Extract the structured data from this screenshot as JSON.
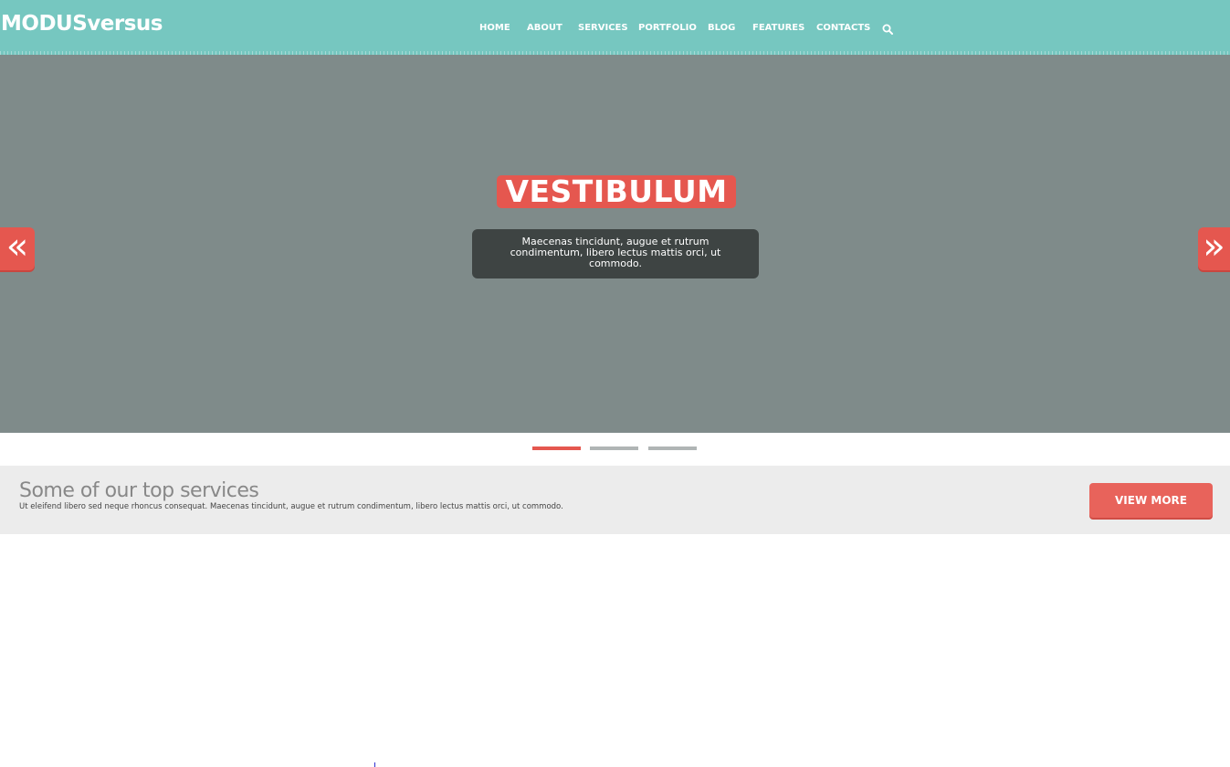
{
  "header": {
    "logo": "MODUSversus",
    "nav": [
      {
        "label": "HOME"
      },
      {
        "label": "ABOUT"
      },
      {
        "label": "SERVICES"
      },
      {
        "label": "PORTFOLIO"
      },
      {
        "label": "BLOG"
      },
      {
        "label": "FEATURES"
      },
      {
        "label": "CONTACTS"
      }
    ],
    "search_icon": "search-icon"
  },
  "slider": {
    "title": "VESTIBULUM",
    "caption": "Maecenas tincidunt, augue et rutrum condimentum, libero lectus mattis orci, ut commodo.",
    "prev_icon": "double-chevron-left-icon",
    "next_icon": "double-chevron-right-icon",
    "prev_glyph": "«",
    "next_glyph": "»",
    "slide_count": 3,
    "active_slide": 1
  },
  "services": {
    "title": "Some of our top services",
    "text": "Ut eleifend libero sed neque rhoncus consequat. Maecenas tincidunt, augue et rutrum condimentum, libero lectus mattis orci, ut commodo.",
    "button_label": "VIEW MORE"
  },
  "colors": {
    "header_bg": "#76c7c0",
    "slider_bg": "#7f8b8a",
    "accent": "#e5574f",
    "caption_bg": "#3e4443",
    "services_bg": "#ececec"
  }
}
